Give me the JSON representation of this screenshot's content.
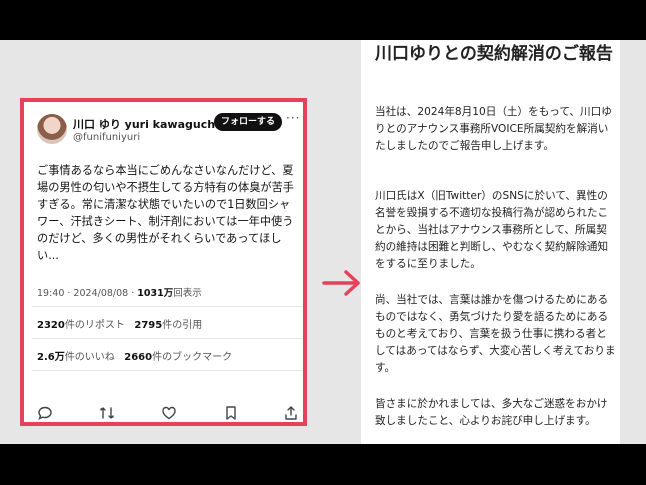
{
  "tweet": {
    "display_name": "川口 ゆり yuri kawaguchi",
    "handle": "@funifuniyuri",
    "follow_label": "フォローする",
    "body": "ご事情あるなら本当にごめんなさいなんだけど、夏場の男性の匂いや不摂生してる方特有の体臭が苦手すぎる。常に清潔な状態でいたいので1日数回シャワー、汗拭きシート、制汗剤においては一年中使うのだけど、多くの男性がそれくらいであってほしい...",
    "time": "19:40 · 2024/08/08 · ",
    "views_count": "1031万",
    "views_label": "回表示",
    "reposts_count": "2320",
    "reposts_label": "件のリポスト",
    "quotes_count": "2795",
    "quotes_label": "件の引用",
    "likes_count": "2.6万",
    "likes_label": "件のいいね",
    "bookmarks_count": "2660",
    "bookmarks_label": "件のブックマーク"
  },
  "notice": {
    "title": "川口ゆりとの契約解消のご報告",
    "para1": "当社は、2024年8月10日（土）をもって、川口ゆりとのアナウンス事務所VOICE所属契約を解消いたしましたのでご報告申し上げます。",
    "para2_before": "川口氏はX（旧Twitter）のSNSに於いて、異性の名誉を毀損する不適切な投稿行為が認められたことから、当社はアナウンス事務所として、所属契約の維持は困難と判断し、やむなく",
    "para2_highlight": "契約解除通知をする",
    "para2_after": "に至りました。",
    "para3": "尚、当社では、言葉は誰かを傷つけるためにあるものではなく、勇気づけたり愛を語るためにあるものと考えており、言葉を扱う仕事に携わる者としてはあってはならず、大変心苦しく考えております。",
    "para4": "皆さまに於かれましては、多大なご迷惑をおかけ致しましたこと、心よりお詫び申し上げます。"
  },
  "colors": {
    "frame": "#e8405a",
    "highlight": "#f5b400",
    "verified": "#1d9bf0"
  }
}
